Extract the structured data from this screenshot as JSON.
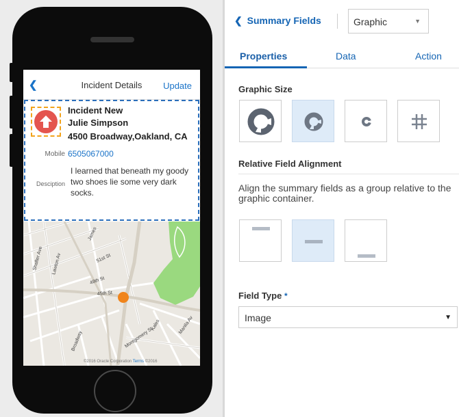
{
  "preview": {
    "header": {
      "back_icon": "chevron-left-icon",
      "title": "Incident Details",
      "action": "Update"
    },
    "card": {
      "icon": "arrow-up-icon",
      "icon_color": "#e4554e",
      "lines": [
        "Incident New",
        "Julie Simpson",
        "4500 Broadway,Oakland, CA"
      ],
      "mobile_label": "Mobile",
      "mobile_value": "6505067000",
      "description_label": "Desciption",
      "description_value": "I learned that beneath my goody two shoes lie some very dark socks."
    },
    "map": {
      "street_labels": [
        "Shafter Ave",
        "Lawton Av",
        "51st St",
        "49th St",
        "45th St",
        "James",
        "Broadway",
        "Montgomery St",
        "Kales",
        "Manila Av"
      ],
      "copyright": "©2016 Oracle Corporation",
      "terms": "Terms",
      "year": "©2016"
    }
  },
  "panel": {
    "back_label": "Summary Fields",
    "graphic_select": {
      "value": "Graphic"
    },
    "tabs": [
      {
        "label": "Properties",
        "active": true
      },
      {
        "label": "Data",
        "active": false
      },
      {
        "label": "Action",
        "active": false
      }
    ],
    "graphic_size": {
      "title": "Graphic Size",
      "options": [
        "extra-large",
        "large",
        "small",
        "none"
      ],
      "selected": "large"
    },
    "alignment": {
      "title": "Relative Field Alignment",
      "description": "Align the summary fields as a group relative to the graphic container.",
      "options": [
        "top",
        "middle",
        "bottom"
      ],
      "selected": "middle"
    },
    "field_type": {
      "label": "Field Type",
      "required_mark": "*",
      "value": "Image"
    }
  },
  "colors": {
    "accent": "#1565b4",
    "link": "#1a73c8",
    "selected_tile": "#deebf8",
    "dashed_card": "#2a6ebb",
    "dashed_graphic": "#f2a31b",
    "map_marker": "#f0841b",
    "park": "#9ad97f"
  }
}
